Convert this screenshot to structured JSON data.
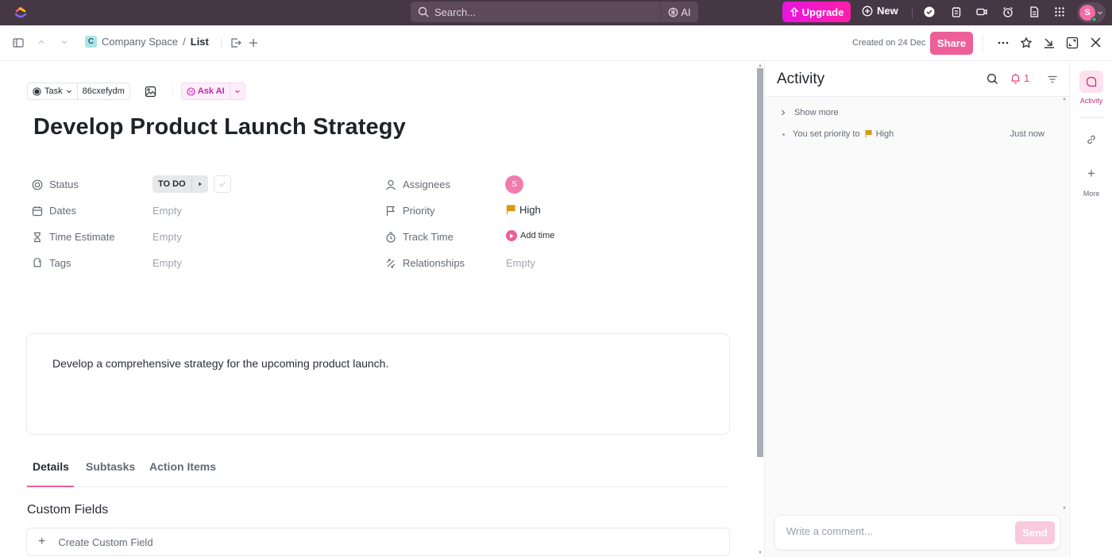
{
  "topbar": {
    "search_placeholder": "Search...",
    "ai_label": "AI",
    "upgrade_label": "Upgrade",
    "new_label": "New",
    "icons": [
      "check-circle-icon",
      "notepad-icon",
      "video-icon",
      "alarm-clock-icon",
      "document-icon",
      "apps-grid-icon"
    ],
    "user_initial": "S"
  },
  "subbar": {
    "breadcrumb": {
      "space_badge": "C",
      "space": "Company Space",
      "separator": "/",
      "list": "List"
    },
    "created": "Created on 24 Dec",
    "share_label": "Share"
  },
  "task": {
    "type_label": "Task",
    "task_id": "86cxefydm",
    "ask_ai_label": "Ask AI",
    "title": "Develop Product Launch Strategy",
    "fields_left": [
      {
        "label": "Status",
        "icon": "status-icon",
        "value": "TO DO"
      },
      {
        "label": "Dates",
        "icon": "calendar-icon",
        "value": "Empty"
      },
      {
        "label": "Time Estimate",
        "icon": "hourglass-icon",
        "value": "Empty"
      },
      {
        "label": "Tags",
        "icon": "tag-icon",
        "value": "Empty"
      }
    ],
    "fields_right": [
      {
        "label": "Assignees",
        "icon": "user-icon",
        "value": "S"
      },
      {
        "label": "Priority",
        "icon": "flag-icon",
        "value": "High"
      },
      {
        "label": "Track Time",
        "icon": "stopwatch-icon",
        "value": "Add time"
      },
      {
        "label": "Relationships",
        "icon": "relationships-icon",
        "value": "Empty"
      }
    ],
    "description": "Develop a comprehensive strategy for the upcoming product launch.",
    "tabs": [
      {
        "label": "Details",
        "active": true
      },
      {
        "label": "Subtasks",
        "active": false
      },
      {
        "label": "Action Items",
        "active": false
      }
    ],
    "custom_fields_title": "Custom Fields",
    "create_custom_field": "Create Custom Field"
  },
  "colors": {
    "accent": "#ee5e99",
    "topbar": "#463745",
    "priority_high": "#d99a0e",
    "upgrade": "#e815e0"
  },
  "activity": {
    "title": "Activity",
    "notification_count": "1",
    "show_more": "Show more",
    "entries": [
      {
        "text": "You set priority to",
        "value": "High",
        "time": "Just now"
      }
    ],
    "comment_placeholder": "Write a comment...",
    "send_label": "Send"
  },
  "rail": {
    "activity_label": "Activity",
    "more_label": "More"
  }
}
